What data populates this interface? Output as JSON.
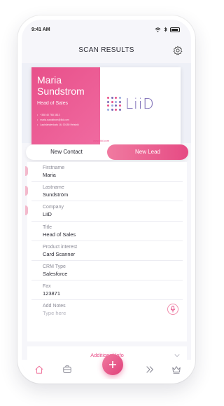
{
  "status": {
    "time": "9:41 AM"
  },
  "header": {
    "title": "SCAN RESULTS"
  },
  "card": {
    "name_first": "Maria",
    "name_last": "Sundstrom",
    "role": "Head of Sales",
    "phone": "+358 40 768 3813",
    "email": "maria.sundstrom@liid.com",
    "address": "Lapinlahdenkatu 16, 00180 Helsinki",
    "logo_text": "LiiD",
    "website": "www.liid.com"
  },
  "toggle": {
    "contact_label": "New Contact",
    "lead_label": "New Lead",
    "selected": "New Lead"
  },
  "fields": [
    {
      "label": "Firstname",
      "value": "Maria"
    },
    {
      "label": "Lastname",
      "value": "Sundström"
    },
    {
      "label": "Company",
      "value": "LiiD"
    },
    {
      "label": "Title",
      "value": "Head of Sales"
    },
    {
      "label": "Product interest",
      "value": "Card Scanner"
    },
    {
      "label": "CRM Type",
      "value": "Salesforce"
    },
    {
      "label": "Fax",
      "value": "123871"
    }
  ],
  "notes": {
    "label": "Add Notes",
    "placeholder": "Type here"
  },
  "additional": {
    "label": "Additional Info"
  },
  "colors": {
    "accent": "#e8508a",
    "accent_light": "#f07aa0",
    "logo": "#7b6bb5"
  },
  "tabbar": {
    "icons": [
      "home-icon",
      "contacts-icon",
      "add-icon",
      "send-icon",
      "crown-icon"
    ]
  }
}
